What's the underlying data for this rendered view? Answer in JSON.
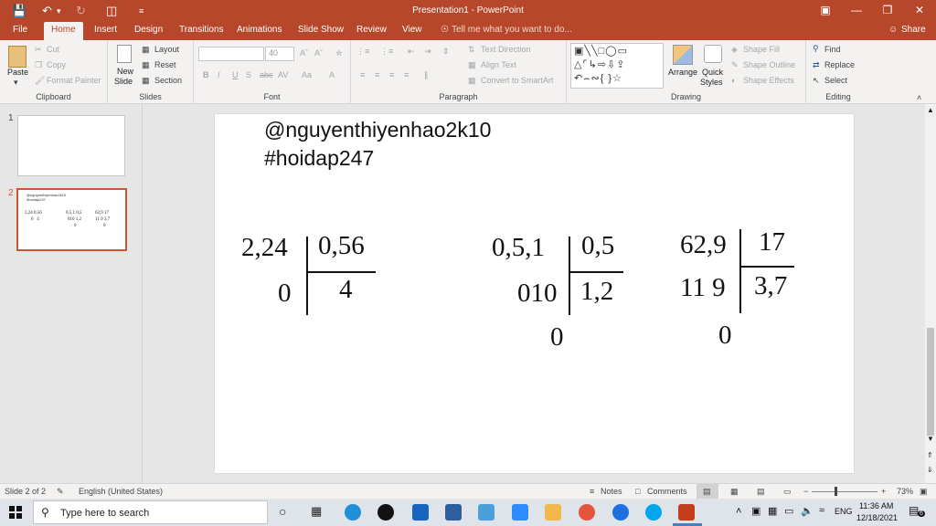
{
  "window": {
    "title": "Presentation1 - PowerPoint"
  },
  "tabs": [
    {
      "label": "File"
    },
    {
      "label": "Home"
    },
    {
      "label": "Insert"
    },
    {
      "label": "Design"
    },
    {
      "label": "Transitions"
    },
    {
      "label": "Animations"
    },
    {
      "label": "Slide Show"
    },
    {
      "label": "Review"
    },
    {
      "label": "View"
    }
  ],
  "tell_me": "Tell me what you want to do...",
  "share": "Share",
  "ribbon": {
    "clipboard": {
      "paste": "Paste",
      "cut": "Cut",
      "copy": "Copy",
      "format_painter": "Format Painter",
      "label": "Clipboard"
    },
    "slides": {
      "new_slide": "New",
      "new_slide2": "Slide",
      "layout": "Layout",
      "reset": "Reset",
      "section": "Section",
      "label": "Slides"
    },
    "font": {
      "font_name": "",
      "font_size": "40",
      "bold": "B",
      "italic": "I",
      "underline": "U",
      "shadow": "S",
      "strike": "abc",
      "spacing": "AV",
      "case": "Aa",
      "color": "A",
      "label": "Font"
    },
    "paragraph": {
      "text_direction": "Text Direction",
      "align_text": "Align Text",
      "smartart": "Convert to SmartArt",
      "label": "Paragraph"
    },
    "drawing": {
      "arrange": "Arrange",
      "quick": "Quick",
      "styles": "Styles",
      "shape_fill": "Shape Fill",
      "shape_outline": "Shape Outline",
      "shape_effects": "Shape Effects",
      "label": "Drawing"
    },
    "editing": {
      "find": "Find",
      "replace": "Replace",
      "select": "Select",
      "label": "Editing"
    }
  },
  "thumbnails": [
    {
      "num": "1"
    },
    {
      "num": "2"
    }
  ],
  "slide": {
    "handle": "@nguyenthiyenhao2k10",
    "hashtag": "#hoidap247",
    "div1": {
      "dividend": "2,24",
      "divisor": "0,56",
      "remainder": "0",
      "quotient": "4"
    },
    "div2": {
      "dividend": "0,5,1",
      "divisor": "0,5",
      "step": "010",
      "quotient": "1,2",
      "remainder": "0"
    },
    "div3": {
      "dividend": "62,9",
      "divisor": "17",
      "step": "11 9",
      "quotient": "3,7",
      "remainder": "0"
    }
  },
  "status": {
    "slide": "Slide 2 of 2",
    "language": "English (United States)",
    "notes": "Notes",
    "comments": "Comments",
    "zoom": "73%"
  },
  "taskbar": {
    "search_placeholder": "Type here to search",
    "time": "11:36 AM",
    "date": "12/18/2021",
    "lang": "ENG",
    "notifications": "6"
  }
}
